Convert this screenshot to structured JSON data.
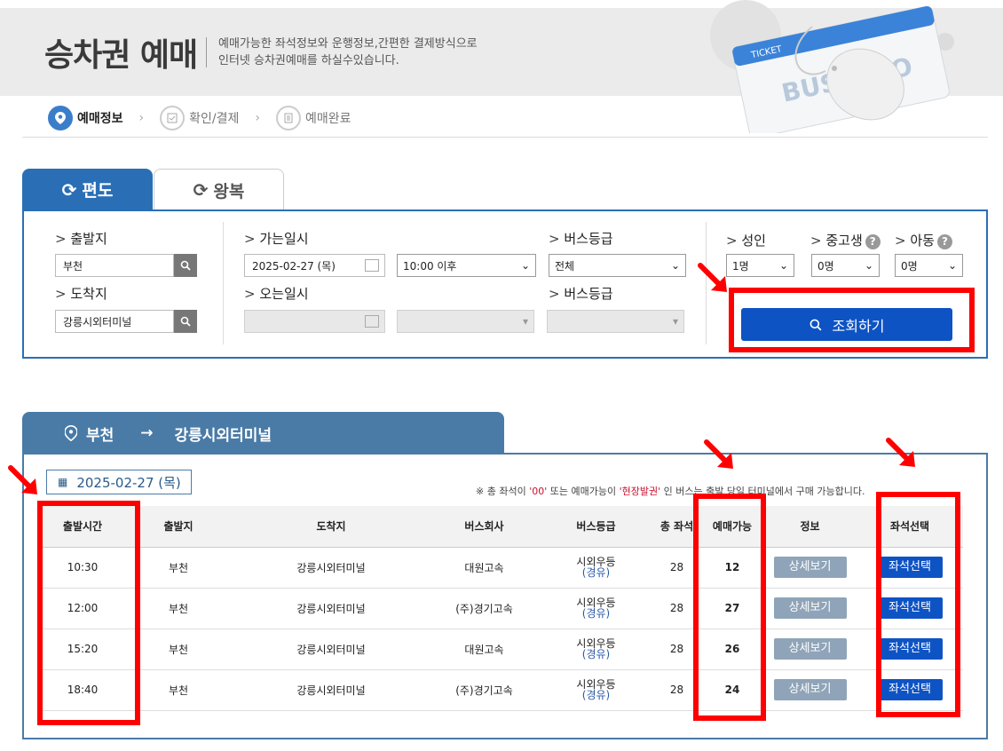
{
  "header": {
    "title": "승차권 예매",
    "desc_line1": "예매가능한 좌석정보와 운행정보,간편한 결제방식으로",
    "desc_line2": "인터넷 승차권예매를 하실수있습니다.",
    "ticket_label": "TICKET",
    "ticket_brand": "BUSTAGO"
  },
  "steps": [
    {
      "label": "예매정보"
    },
    {
      "label": "확인/결제"
    },
    {
      "label": "예매완료"
    }
  ],
  "tabs": {
    "oneway": "편도",
    "roundtrip": "왕복"
  },
  "search": {
    "origin_label": "출발지",
    "origin_value": "부천",
    "dest_label": "도착지",
    "dest_value": "강릉시외터미널",
    "depart_label": "가는일시",
    "depart_date": "2025-02-27 (목)",
    "depart_time": "10:00 이후",
    "return_label": "오는일시",
    "grade_label": "버스등급",
    "grade_value": "전체",
    "grade2_label": "버스등급",
    "adult_label": "성인",
    "adult_value": "1명",
    "youth_label": "중고생",
    "youth_value": "0명",
    "child_label": "아동",
    "child_value": "0명",
    "query_button": "조회하기"
  },
  "results": {
    "route_from": "부천",
    "route_to": "강릉시외터미널",
    "date": "2025-02-27 (목)",
    "notice_pre": "※ 총 좌석이 ",
    "notice_zero": "'00'",
    "notice_mid": " 또는 예매가능이 ",
    "notice_onsite": "'현장발권'",
    "notice_post": " 인 버스는 출발 당일 터미널에서 구매 가능합니다.",
    "columns": [
      "출발시간",
      "출발지",
      "도착지",
      "버스회사",
      "버스등급",
      "총 좌석",
      "예매가능",
      "정보",
      "좌석선택"
    ],
    "rows": [
      {
        "time": "10:30",
        "from": "부천",
        "to": "강릉시외터미널",
        "company": "대원고속",
        "grade": "시외우등",
        "grade_sub": "(경유)",
        "total": "28",
        "available": "12",
        "detail": "상세보기",
        "seat": "좌석선택"
      },
      {
        "time": "12:00",
        "from": "부천",
        "to": "강릉시외터미널",
        "company": "(주)경기고속",
        "grade": "시외우등",
        "grade_sub": "(경유)",
        "total": "28",
        "available": "27",
        "detail": "상세보기",
        "seat": "좌석선택"
      },
      {
        "time": "15:20",
        "from": "부천",
        "to": "강릉시외터미널",
        "company": "대원고속",
        "grade": "시외우등",
        "grade_sub": "(경유)",
        "total": "28",
        "available": "26",
        "detail": "상세보기",
        "seat": "좌석선택"
      },
      {
        "time": "18:40",
        "from": "부천",
        "to": "강릉시외터미널",
        "company": "(주)경기고속",
        "grade": "시외우등",
        "grade_sub": "(경유)",
        "total": "28",
        "available": "24",
        "detail": "상세보기",
        "seat": "좌석선택"
      }
    ]
  },
  "colors": {
    "primary": "#2a6fb6",
    "button": "#0e53c4",
    "route": "#4a7ba7",
    "highlight": "#ff0000"
  }
}
